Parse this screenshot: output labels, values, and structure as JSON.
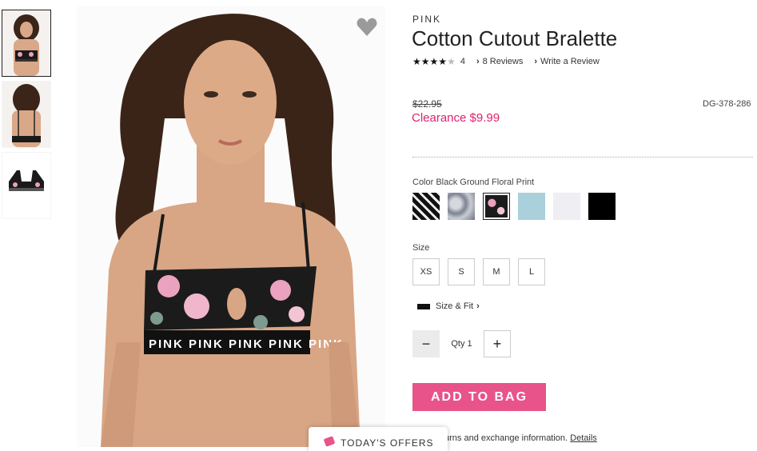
{
  "thumbnails": [
    {
      "icon": "model-front-thumbnail",
      "active": true
    },
    {
      "icon": "model-back-thumbnail",
      "active": false
    },
    {
      "icon": "product-flat-thumbnail",
      "active": false
    }
  ],
  "favorite_icon": "heart-icon",
  "product": {
    "brand": "PINK",
    "title": "Cotton Cutout Bralette",
    "rating_value": 4,
    "rating_count": "4",
    "reviews_link": "8 Reviews",
    "write_review_link": "Write a Review",
    "original_price": "$22.95",
    "sku": "DG-378-286",
    "clearance_price": "Clearance $9.99"
  },
  "color": {
    "label": "Color Black Ground Floral Print",
    "swatches": [
      {
        "name": "black-white-logo",
        "color": "#2a2a2a"
      },
      {
        "name": "grey-marble",
        "color": "#8f95a3"
      },
      {
        "name": "black-ground-floral",
        "color": "#1b1b1b",
        "selected": true
      },
      {
        "name": "light-blue",
        "color": "#a9d0db"
      },
      {
        "name": "white",
        "color": "#eeeef3"
      },
      {
        "name": "black",
        "color": "#000000"
      }
    ]
  },
  "size": {
    "label": "Size",
    "options": [
      "XS",
      "S",
      "M",
      "L"
    ],
    "fit_link": "Size & Fit"
  },
  "quantity": {
    "text": "Qty 1",
    "minus_icon": "minus-icon",
    "plus_icon": "plus-icon"
  },
  "add_to_bag": "ADD TO BAG",
  "returns": {
    "text": "urns and exchange information.",
    "details_link": "Details"
  },
  "offers_tab": "TODAY'S OFFERS",
  "colors": {
    "accent_pink": "#e8538a",
    "clearance_pink": "#e0206f"
  }
}
